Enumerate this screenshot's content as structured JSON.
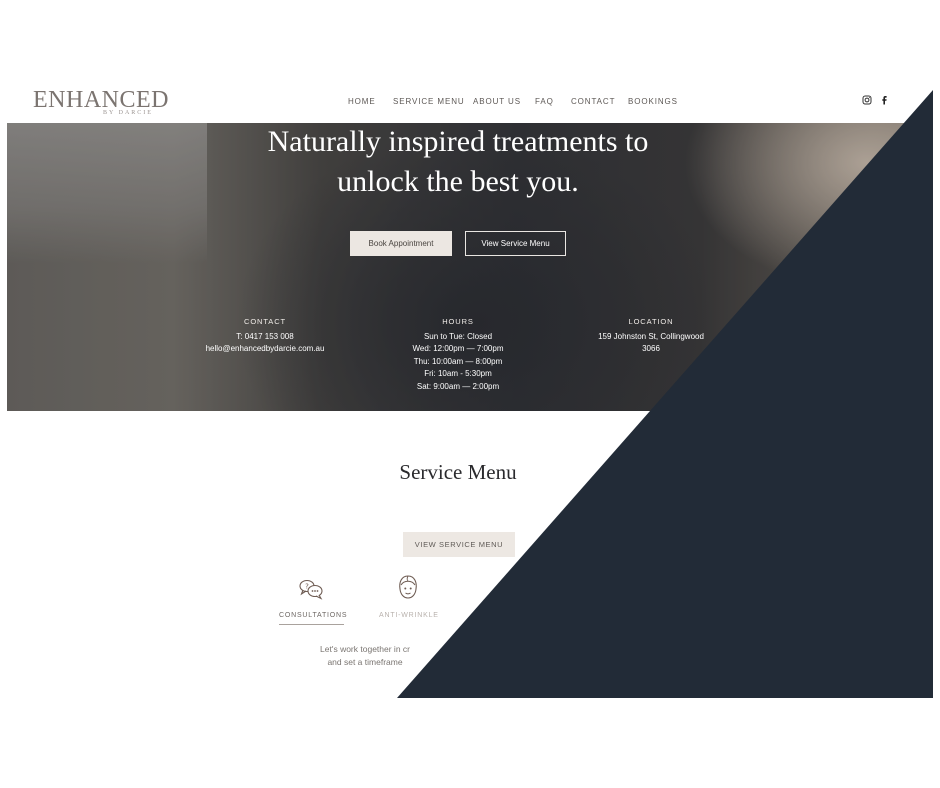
{
  "header": {
    "logo": {
      "main": "ENHANCED",
      "sub": "BY DARCIE"
    },
    "nav": [
      {
        "label": "HOME"
      },
      {
        "label": "SERVICE MENU"
      },
      {
        "label": "ABOUT US"
      },
      {
        "label": "FAQ"
      },
      {
        "label": "CONTACT"
      },
      {
        "label": "BOOKINGS"
      }
    ],
    "social": [
      {
        "icon": "instagram-icon"
      },
      {
        "icon": "facebook-icon"
      }
    ]
  },
  "hero": {
    "title_line1": "Naturally inspired treatments to",
    "title_line2": "unlock the best you.",
    "book_button": "Book Appointment",
    "menu_button": "View Service Menu",
    "contact": {
      "heading": "CONTACT",
      "phone": "T: 0417 153 008",
      "email": "hello@enhancedbydarcie.com.au"
    },
    "hours": {
      "heading": "HOURS",
      "lines": [
        "Sun to Tue: Closed",
        "Wed: 12:00pm — 7:00pm",
        "Thu: 10:00am — 8:00pm",
        "Fri: 10am - 5:30pm",
        "Sat: 9:00am — 2:00pm"
      ]
    },
    "location": {
      "heading": "LOCATION",
      "line1": "159 Johnston St, Collingwood",
      "line2": "3066"
    }
  },
  "services": {
    "title": "Service Menu",
    "button": "VIEW SERVICE MENU",
    "categories": [
      {
        "label": "CONSULTATIONS",
        "icon": "chat-bubbles-icon",
        "active": true
      },
      {
        "label": "ANTI-WRINKLE",
        "icon": "face-icon",
        "active": false
      }
    ],
    "description_line1": "Let's work together in cr",
    "description_line2": "and set a timeframe"
  },
  "colors": {
    "overlay": "#222b37",
    "button_beige": "#ece7e2",
    "text_dark": "#2a2a2d",
    "nav_text": "#5d5855",
    "muted_label": "#b8b1ac"
  }
}
